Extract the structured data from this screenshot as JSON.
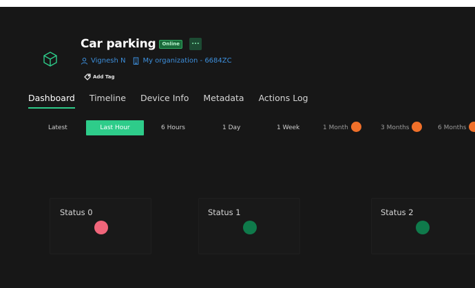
{
  "device": {
    "title": "Car parking",
    "status_badge": "Online",
    "more_label": "...",
    "owner": "Vignesh N",
    "organization": "My organization - 6684ZC",
    "add_tag_label": "Add Tag"
  },
  "tabs": [
    {
      "label": "Dashboard",
      "active": true
    },
    {
      "label": "Timeline",
      "active": false
    },
    {
      "label": "Device Info",
      "active": false
    },
    {
      "label": "Metadata",
      "active": false
    },
    {
      "label": "Actions Log",
      "active": false
    }
  ],
  "time_ranges": [
    {
      "label": "Latest",
      "active": false,
      "premium": false
    },
    {
      "label": "Last Hour",
      "active": true,
      "premium": false
    },
    {
      "label": "6 Hours",
      "active": false,
      "premium": false
    },
    {
      "label": "1 Day",
      "active": false,
      "premium": false
    },
    {
      "label": "1 Week",
      "active": false,
      "premium": false
    },
    {
      "label": "1 Month",
      "active": false,
      "premium": true
    },
    {
      "label": "3 Months",
      "active": false,
      "premium": true
    },
    {
      "label": "6 Months",
      "active": false,
      "premium": true
    }
  ],
  "widgets": [
    {
      "label": "Status 0",
      "state_color": "#f0657a"
    },
    {
      "label": "Status 1",
      "state_color": "#0f7a4b"
    },
    {
      "label": "Status 2",
      "state_color": "#0f7a4b"
    }
  ],
  "colors": {
    "accent": "#2ecc8a",
    "link": "#3d8fdc",
    "background": "#171717",
    "premium_lock": "#f0702a"
  },
  "icons": {
    "device": "cube-icon",
    "owner": "user-icon",
    "organization": "building-icon",
    "tag": "tag-icon",
    "premium": "lock-icon"
  }
}
